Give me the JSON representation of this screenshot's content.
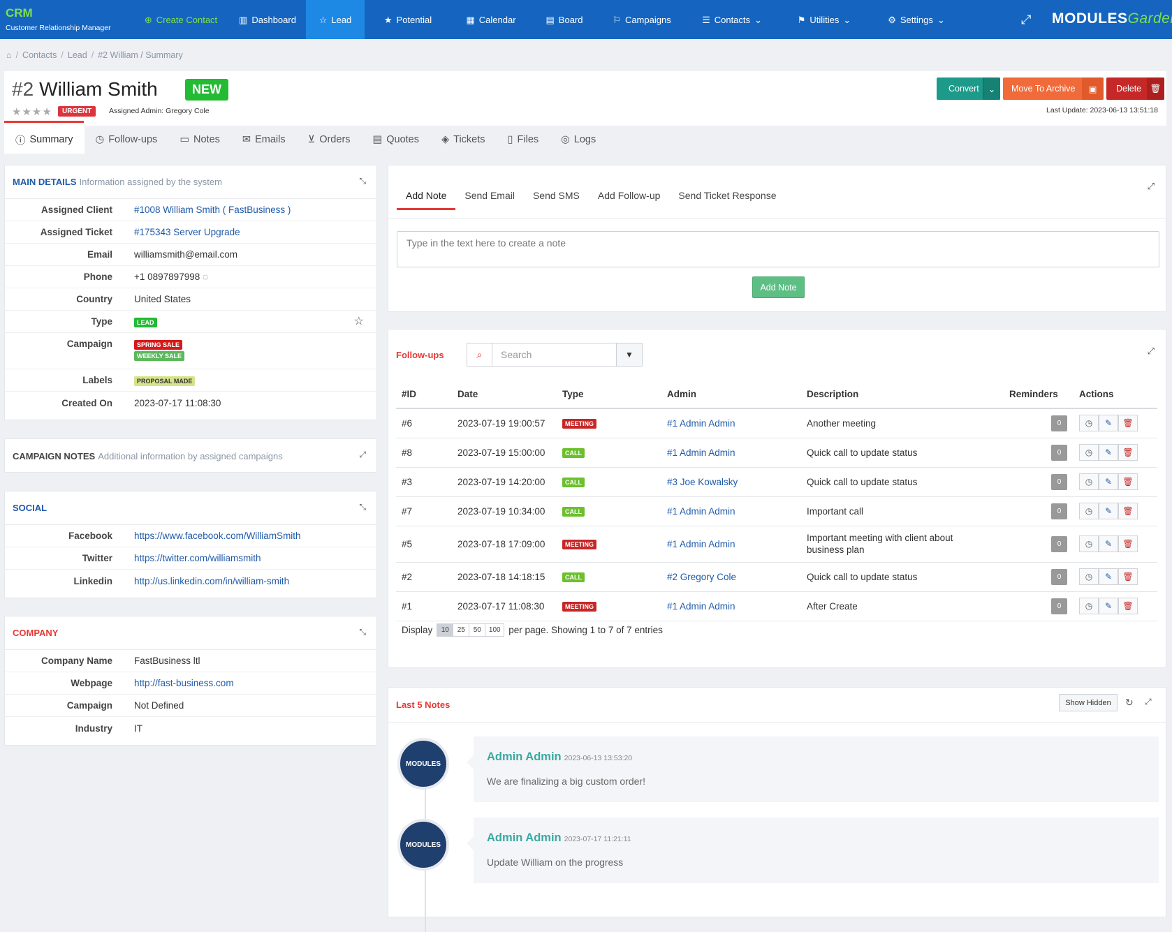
{
  "app": {
    "name": "CRM",
    "subtitle": "Customer Relationship Manager",
    "logo_main": "MODULES",
    "logo_sub": "Garden"
  },
  "nav": {
    "create": "Create Contact",
    "items": [
      {
        "label": "Dashboard",
        "icon": "bar-chart-icon"
      },
      {
        "label": "Lead",
        "icon": "star-outline-icon"
      },
      {
        "label": "Potential",
        "icon": "star-icon"
      },
      {
        "label": "Calendar",
        "icon": "calendar-icon"
      },
      {
        "label": "Board",
        "icon": "board-icon"
      },
      {
        "label": "Campaigns",
        "icon": "flag-icon"
      },
      {
        "label": "Contacts",
        "icon": "list-icon"
      },
      {
        "label": "Utilities",
        "icon": "signpost-icon"
      },
      {
        "label": "Settings",
        "icon": "gear-icon"
      }
    ]
  },
  "breadcrumb": [
    "Contacts",
    "Lead",
    "#2 William / Summary"
  ],
  "contact": {
    "number": "#2",
    "name": "William Smith",
    "status": "NEW",
    "priority": "URGENT",
    "assigned_admin": "Assigned Admin: Gregory Cole",
    "last_update": "Last Update: 2023-06-13 13:51:18"
  },
  "actions": {
    "convert": "Convert",
    "archive": "Move To Archive",
    "delete": "Delete"
  },
  "tabs": [
    "Summary",
    "Follow-ups",
    "Notes",
    "Emails",
    "Orders",
    "Quotes",
    "Tickets",
    "Files",
    "Logs"
  ],
  "main_details": {
    "title": "Main Details",
    "subtitle": "Information assigned by the system",
    "rows": {
      "client_label": "Assigned Client",
      "client": "#1008 William Smith ( FastBusiness )",
      "ticket_label": "Assigned Ticket",
      "ticket": "#175343 Server Upgrade",
      "email_label": "Email",
      "email": "williamsmith@email.com",
      "phone_label": "Phone",
      "phone": "+1 0897897998",
      "country_label": "Country",
      "country": "United States",
      "type_label": "Type",
      "type": "LEAD",
      "campaign_label": "Campaign",
      "campaign1": "SPRING SALE",
      "campaign2": "WEEKLY SALE",
      "labels_label": "Labels",
      "labels": "PROPOSAL MADE",
      "created_label": "Created On",
      "created": "2023-07-17 11:08:30"
    }
  },
  "campaign_notes": {
    "title": "Campaign Notes",
    "subtitle": "Additional information by assigned campaigns"
  },
  "social": {
    "title": "Social",
    "facebook_label": "Facebook",
    "facebook": "https://www.facebook.com/WilliamSmith",
    "twitter_label": "Twitter",
    "twitter": "https://twitter.com/williamsmith",
    "linkedin_label": "Linkedin",
    "linkedin": "http://us.linkedin.com/in/william-smith"
  },
  "company": {
    "title": "Company",
    "name_label": "Company Name",
    "name": "FastBusiness ltl",
    "webpage_label": "Webpage",
    "webpage": "http://fast-business.com",
    "campaign_label": "Campaign",
    "campaign": "Not Defined",
    "industry_label": "Industry",
    "industry": "IT"
  },
  "note_form": {
    "tabs": [
      "Add Note",
      "Send Email",
      "Send SMS",
      "Add Follow-up",
      "Send Ticket Response"
    ],
    "placeholder": "Type in the text here to create a note",
    "submit": "Add Note"
  },
  "followups": {
    "title": "Follow-ups",
    "search_placeholder": "Search",
    "headers": [
      "#ID",
      "Date",
      "Type",
      "Admin",
      "Description",
      "Reminders",
      "Actions"
    ],
    "rows": [
      {
        "id": "#6",
        "date": "2023-07-19 19:00:57",
        "type": "MEETING",
        "admin": "#1 Admin Admin",
        "desc": "Another meeting",
        "rem": "0"
      },
      {
        "id": "#8",
        "date": "2023-07-19 15:00:00",
        "type": "CALL",
        "admin": "#1 Admin Admin",
        "desc": "Quick call to update status",
        "rem": "0"
      },
      {
        "id": "#3",
        "date": "2023-07-19 14:20:00",
        "type": "CALL",
        "admin": "#3 Joe Kowalsky",
        "desc": "Quick call to update status",
        "rem": "0"
      },
      {
        "id": "#7",
        "date": "2023-07-19 10:34:00",
        "type": "CALL",
        "admin": "#1 Admin Admin",
        "desc": "Important call",
        "rem": "0"
      },
      {
        "id": "#5",
        "date": "2023-07-18 17:09:00",
        "type": "MEETING",
        "admin": "#1 Admin Admin",
        "desc": "Important meeting with client about business plan",
        "rem": "0"
      },
      {
        "id": "#2",
        "date": "2023-07-18 14:18:15",
        "type": "CALL",
        "admin": "#2 Gregory Cole",
        "desc": "Quick call to update status",
        "rem": "0"
      },
      {
        "id": "#1",
        "date": "2023-07-17 11:08:30",
        "type": "MEETING",
        "admin": "#1 Admin Admin",
        "desc": "After Create",
        "rem": "0"
      }
    ],
    "display_label": "Display",
    "page_sizes": [
      "10",
      "25",
      "50",
      "100"
    ],
    "showing": "per page. Showing 1 to 7 of 7 entries"
  },
  "last_notes": {
    "title": "Last 5 Notes",
    "show_hidden": "Show Hidden",
    "notes": [
      {
        "author": "Admin Admin",
        "date": "2023-06-13 13:53:20",
        "text": "We are finalizing a big custom order!"
      },
      {
        "author": "Admin Admin",
        "date": "2023-07-17 11:21:11",
        "text": "Update William on the progress"
      }
    ]
  },
  "colors": {
    "topbar": "#1565c0",
    "active_nav": "#1e88e5",
    "accent_red": "#e53935",
    "brand_green": "#7ee04a"
  }
}
